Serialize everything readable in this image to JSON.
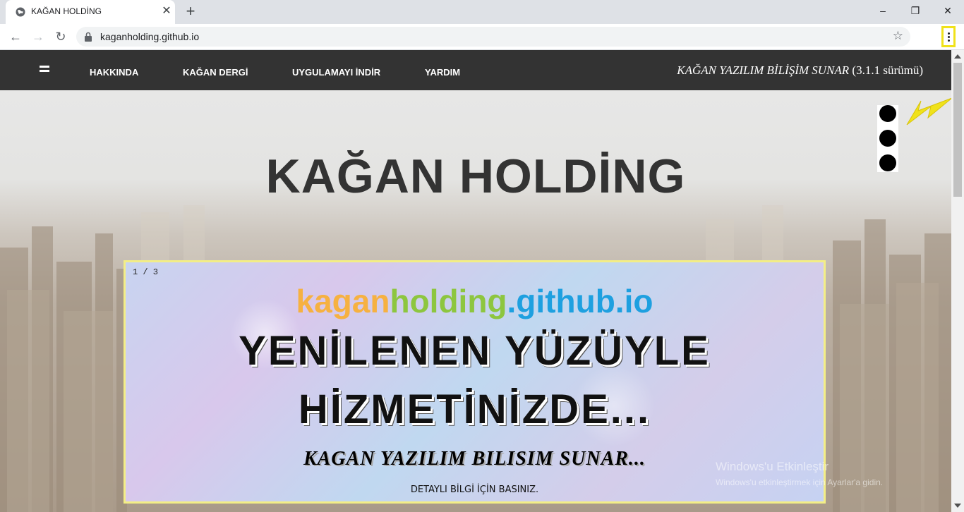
{
  "browser": {
    "tab_title": "KAĞAN HOLDİNG",
    "url": "kaganholding.github.io",
    "window_controls": {
      "minimize": "–",
      "maximize": "❐",
      "close": "✕"
    }
  },
  "navbar": {
    "links": [
      "HAKKINDA",
      "KAĞAN DERGİ",
      "UYGULAMAYI İNDİR",
      "YARDIM"
    ],
    "brand_italic": "KAĞAN YAZILIM BİLİŞİM SUNAR",
    "brand_version": "(3.1.1 sürümü)"
  },
  "hero": {
    "title": "KAĞAN HOLDİNG"
  },
  "slide": {
    "counter": "1 / 3",
    "domain_part1": "kagan",
    "domain_part2": "holding",
    "domain_part3": ".github.io",
    "headline_line1": "YENİLENEN YÜZÜYLE",
    "headline_line2": "HİZMETİNİZDE...",
    "subtitle": "KAGAN YAZILIM BILISIM SUNAR...",
    "cta": "DETAYLI BİLGİ İÇİN BASINIZ."
  },
  "watermark": {
    "line1": "Windows'u Etkinleştir",
    "line2": "Windows'u etkinleştirmek için Ayarlar'a gidin."
  },
  "colors": {
    "annotation_highlight": "#f0e21a",
    "domain_orange": "#f6b141",
    "domain_green": "#8dc63f",
    "domain_blue": "#1ea0e0",
    "navbar_bg": "#333333"
  }
}
